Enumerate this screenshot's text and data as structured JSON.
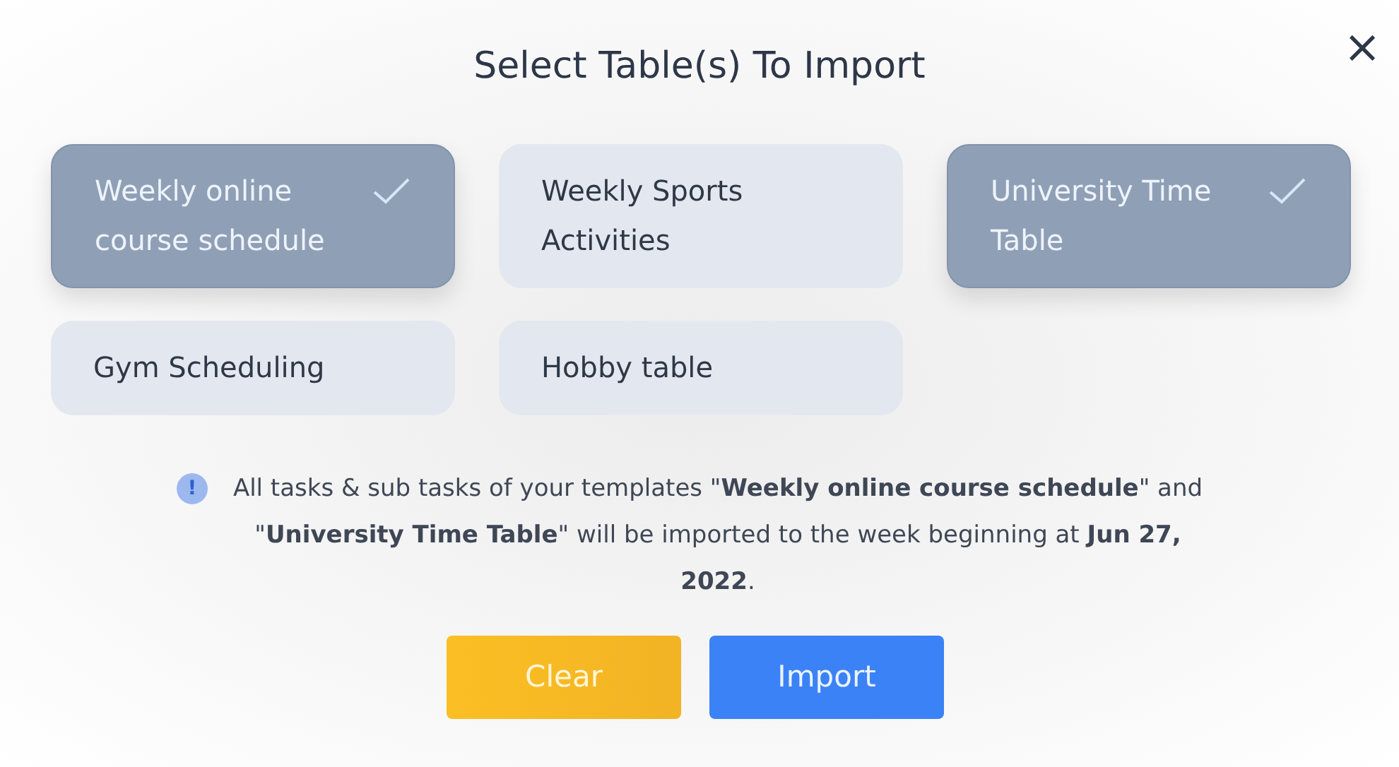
{
  "dialog": {
    "title": "Select Table(s) To Import",
    "close": "×"
  },
  "tables": [
    {
      "label": "Weekly online course schedule",
      "selected": true
    },
    {
      "label": "Weekly Sports Activities",
      "selected": false
    },
    {
      "label": "University Time Table",
      "selected": true
    },
    {
      "label": "Gym Scheduling",
      "selected": false
    },
    {
      "label": "Hobby table",
      "selected": false
    }
  ],
  "info": {
    "icon": "!",
    "message": "All tasks & sub tasks of your templates \"**Weekly online course schedule**\" and \"**University Time Table**\" will be imported to the week beginning at  **Jun 27, 2022**."
  },
  "buttons": [
    {
      "label": "Clear",
      "kind": "secondary"
    },
    {
      "label": "Import",
      "kind": "primary"
    }
  ]
}
